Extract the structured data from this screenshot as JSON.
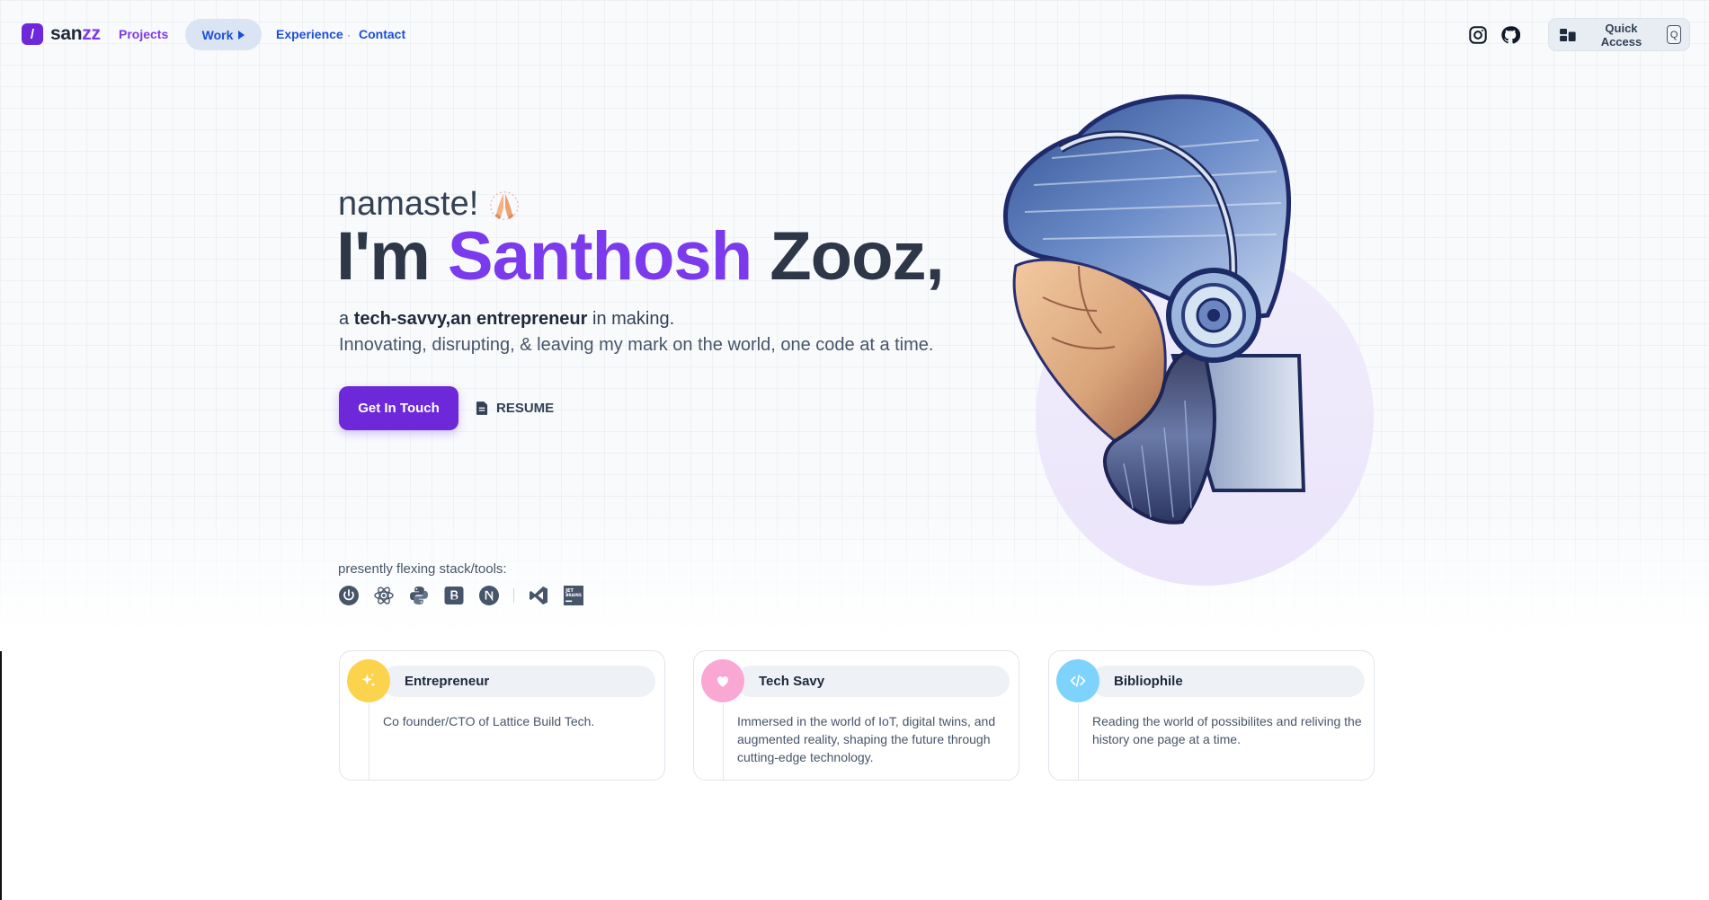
{
  "nav": {
    "logo_mark": "/",
    "logo_main": "san",
    "logo_accent": "zz",
    "links": {
      "projects": "Projects",
      "work": "Work",
      "experience": "Experience",
      "dot": "·",
      "contact": "Contact"
    },
    "social_icons": [
      "instagram-icon",
      "github-icon"
    ],
    "quick_access": {
      "label": "Quick Access",
      "shortcut": "Q"
    }
  },
  "hero": {
    "greeting": "namaste!",
    "greeting_emoji": "🙏",
    "headline_prefix": "I'm ",
    "headline_name": "Santhosh",
    "headline_suffix": " Zooz,",
    "tagline_a": "a ",
    "tagline_bold": "tech-savvy,an entrepreneur",
    "tagline_c": " in making.",
    "subline": "Innovating, disrupting, & leaving my mark on the world, one code at a time.",
    "cta_label": "Get In Touch",
    "resume_label": "RESUME"
  },
  "stack": {
    "label": "presently flexing stack/tools:",
    "tools": [
      "power-icon",
      "react-icon",
      "python-icon",
      "bootstrap-icon",
      "nextjs-icon",
      "vscode-icon",
      "jetbrains-icon"
    ]
  },
  "cards": [
    {
      "title": "Entrepreneur",
      "desc": "Co founder/CTO of Lattice Build Tech.",
      "color": "#fcd34d",
      "icon": "sparkles-icon"
    },
    {
      "title": "Tech Savy",
      "desc": "Immersed in the world of IoT, digital twins, and augmented reality, shaping the future through cutting-edge technology.",
      "color": "#f9a8d4",
      "icon": "heart-icon"
    },
    {
      "title": "Bibliophile",
      "desc": "Reading the world of possibilites and reliving the history one page at a time.",
      "color": "#7dd3fc",
      "icon": "code-icon"
    }
  ],
  "colors": {
    "accent": "#7c3aed",
    "button": "#6d28d9",
    "link": "#1d4ed8"
  }
}
